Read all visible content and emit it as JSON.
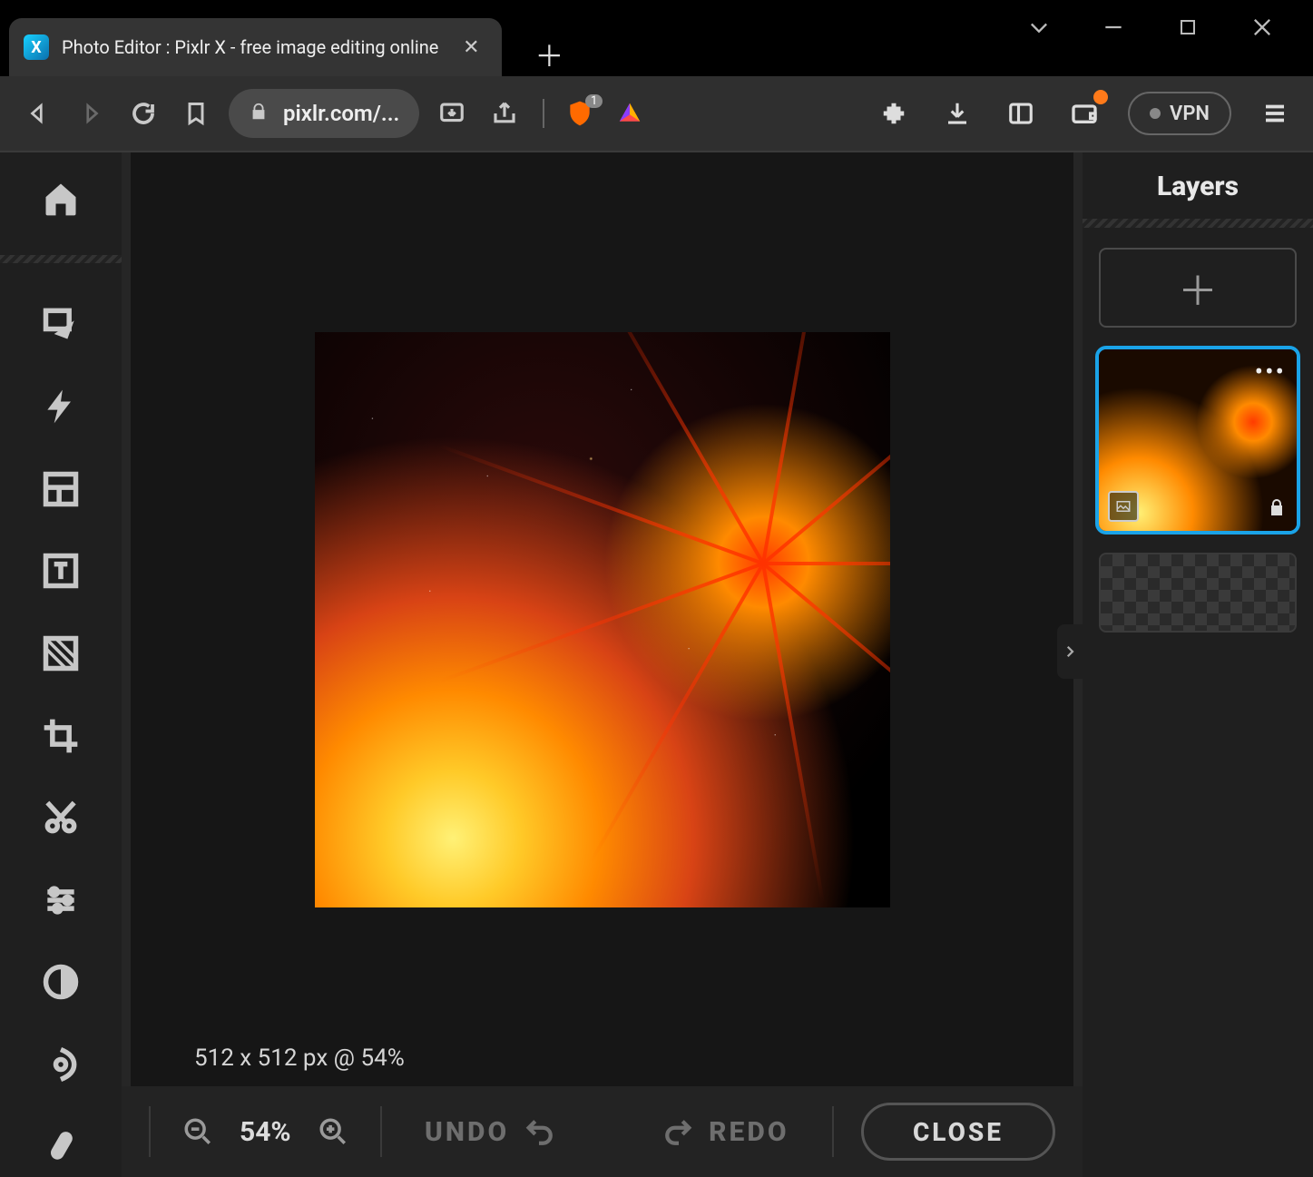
{
  "browser": {
    "tab_title": "Photo Editor : Pixlr X - free image editing online",
    "url_display": "pixlr.com/...",
    "brave_shield_count": "1",
    "vpn_label": "VPN"
  },
  "tools": [
    {
      "name": "home-icon"
    },
    {
      "name": "arrange-icon"
    },
    {
      "name": "ai-bolt-icon"
    },
    {
      "name": "layout-icon"
    },
    {
      "name": "text-icon"
    },
    {
      "name": "fill-icon"
    },
    {
      "name": "crop-icon"
    },
    {
      "name": "cut-icon"
    },
    {
      "name": "adjust-icon"
    },
    {
      "name": "contrast-icon"
    },
    {
      "name": "liquify-icon"
    },
    {
      "name": "draw-icon"
    }
  ],
  "canvas": {
    "info": "512 x 512 px @ 54%"
  },
  "bottom": {
    "zoom_pct": "54%",
    "undo_label": "UNDO",
    "redo_label": "REDO",
    "close_label": "CLOSE"
  },
  "layers": {
    "title": "Layers",
    "items": [
      {
        "selected": true,
        "locked": true,
        "type": "image"
      },
      {
        "empty": true
      }
    ]
  }
}
